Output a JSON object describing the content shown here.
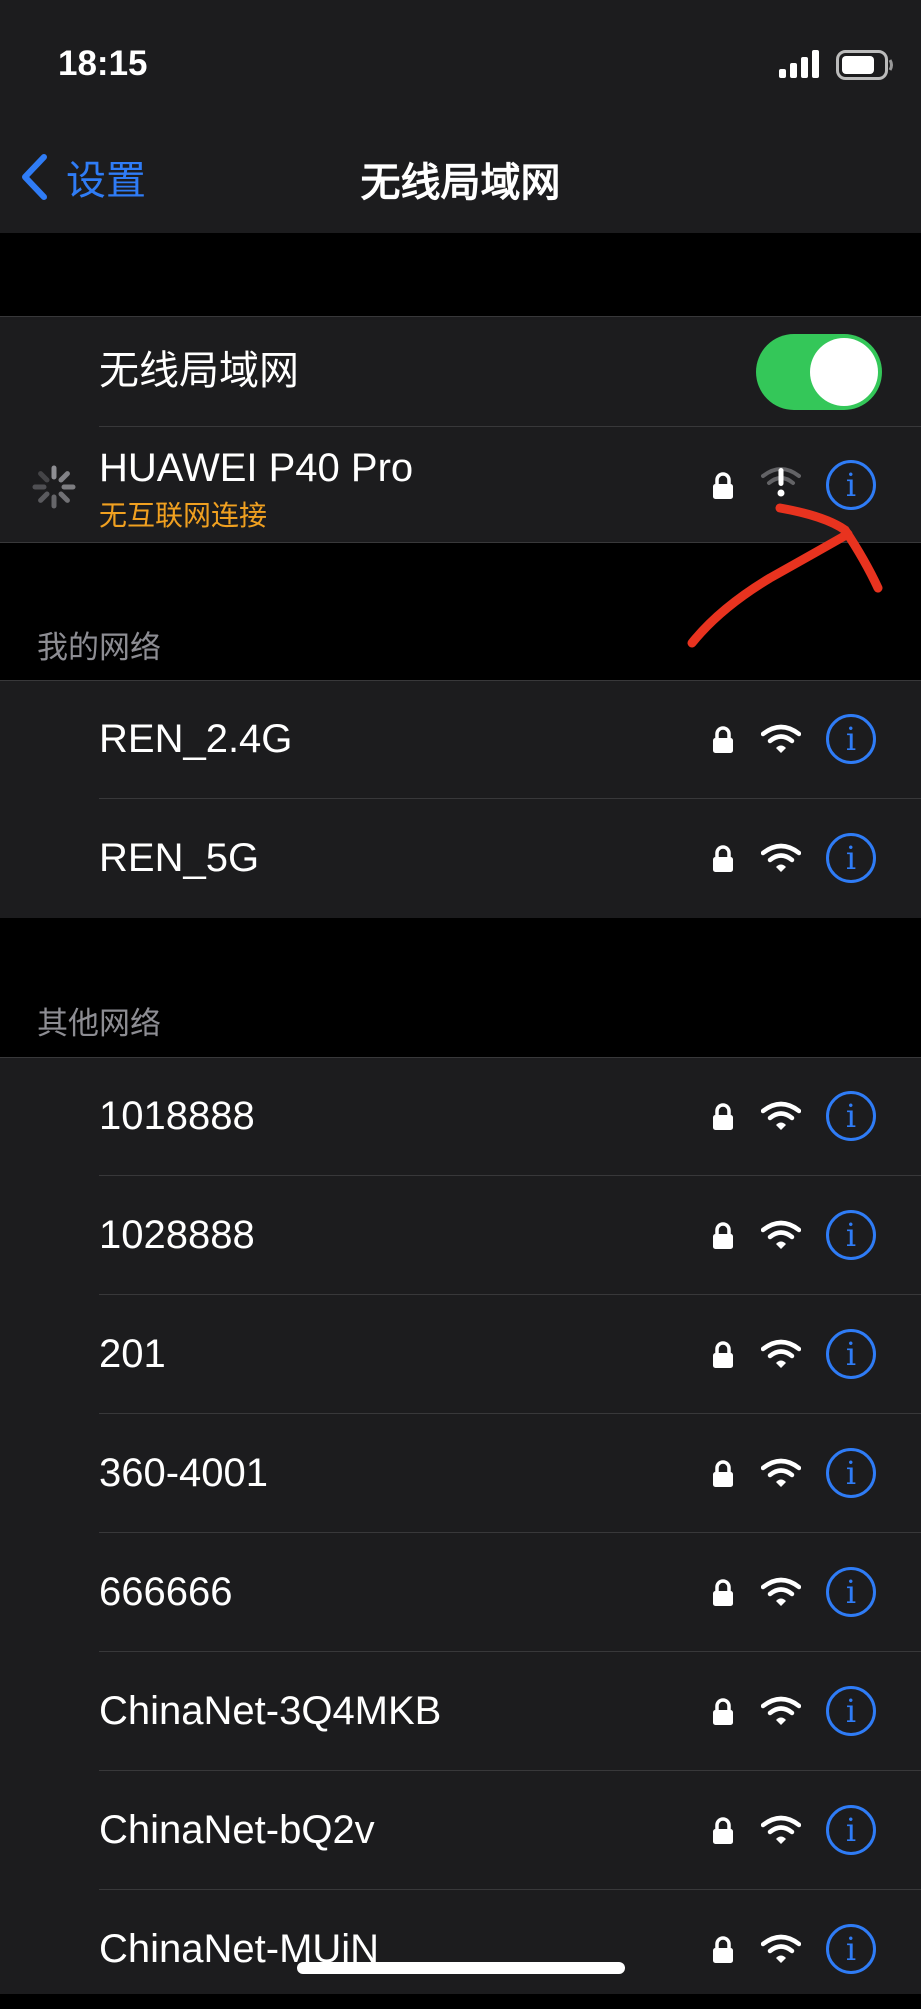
{
  "status_bar": {
    "time": "18:15",
    "signal_icon": "cellular-signal-icon",
    "battery_icon": "battery-icon"
  },
  "nav": {
    "back_label": "设置",
    "title": "无线局域网"
  },
  "wifi_toggle": {
    "label": "无线局域网",
    "on": true
  },
  "current": {
    "name": "HUAWEI P40 Pro",
    "status": "无互联网连接",
    "status_color": "#f0a020"
  },
  "sections": {
    "my_networks": "我的网络",
    "other_networks": "其他网络"
  },
  "my_networks": [
    {
      "name": "REN_2.4G"
    },
    {
      "name": "REN_5G"
    }
  ],
  "other_networks": [
    {
      "name": "1018888"
    },
    {
      "name": "1028888"
    },
    {
      "name": "201"
    },
    {
      "name": "360-4001"
    },
    {
      "name": "666666"
    },
    {
      "name": "ChinaNet-3Q4MKB"
    },
    {
      "name": "ChinaNet-bQ2v"
    },
    {
      "name": "ChinaNet-MUiN"
    }
  ],
  "colors": {
    "accent": "#2f7cf6",
    "toggle_on": "#34c759",
    "annotation_arrow": "#e8331f"
  }
}
